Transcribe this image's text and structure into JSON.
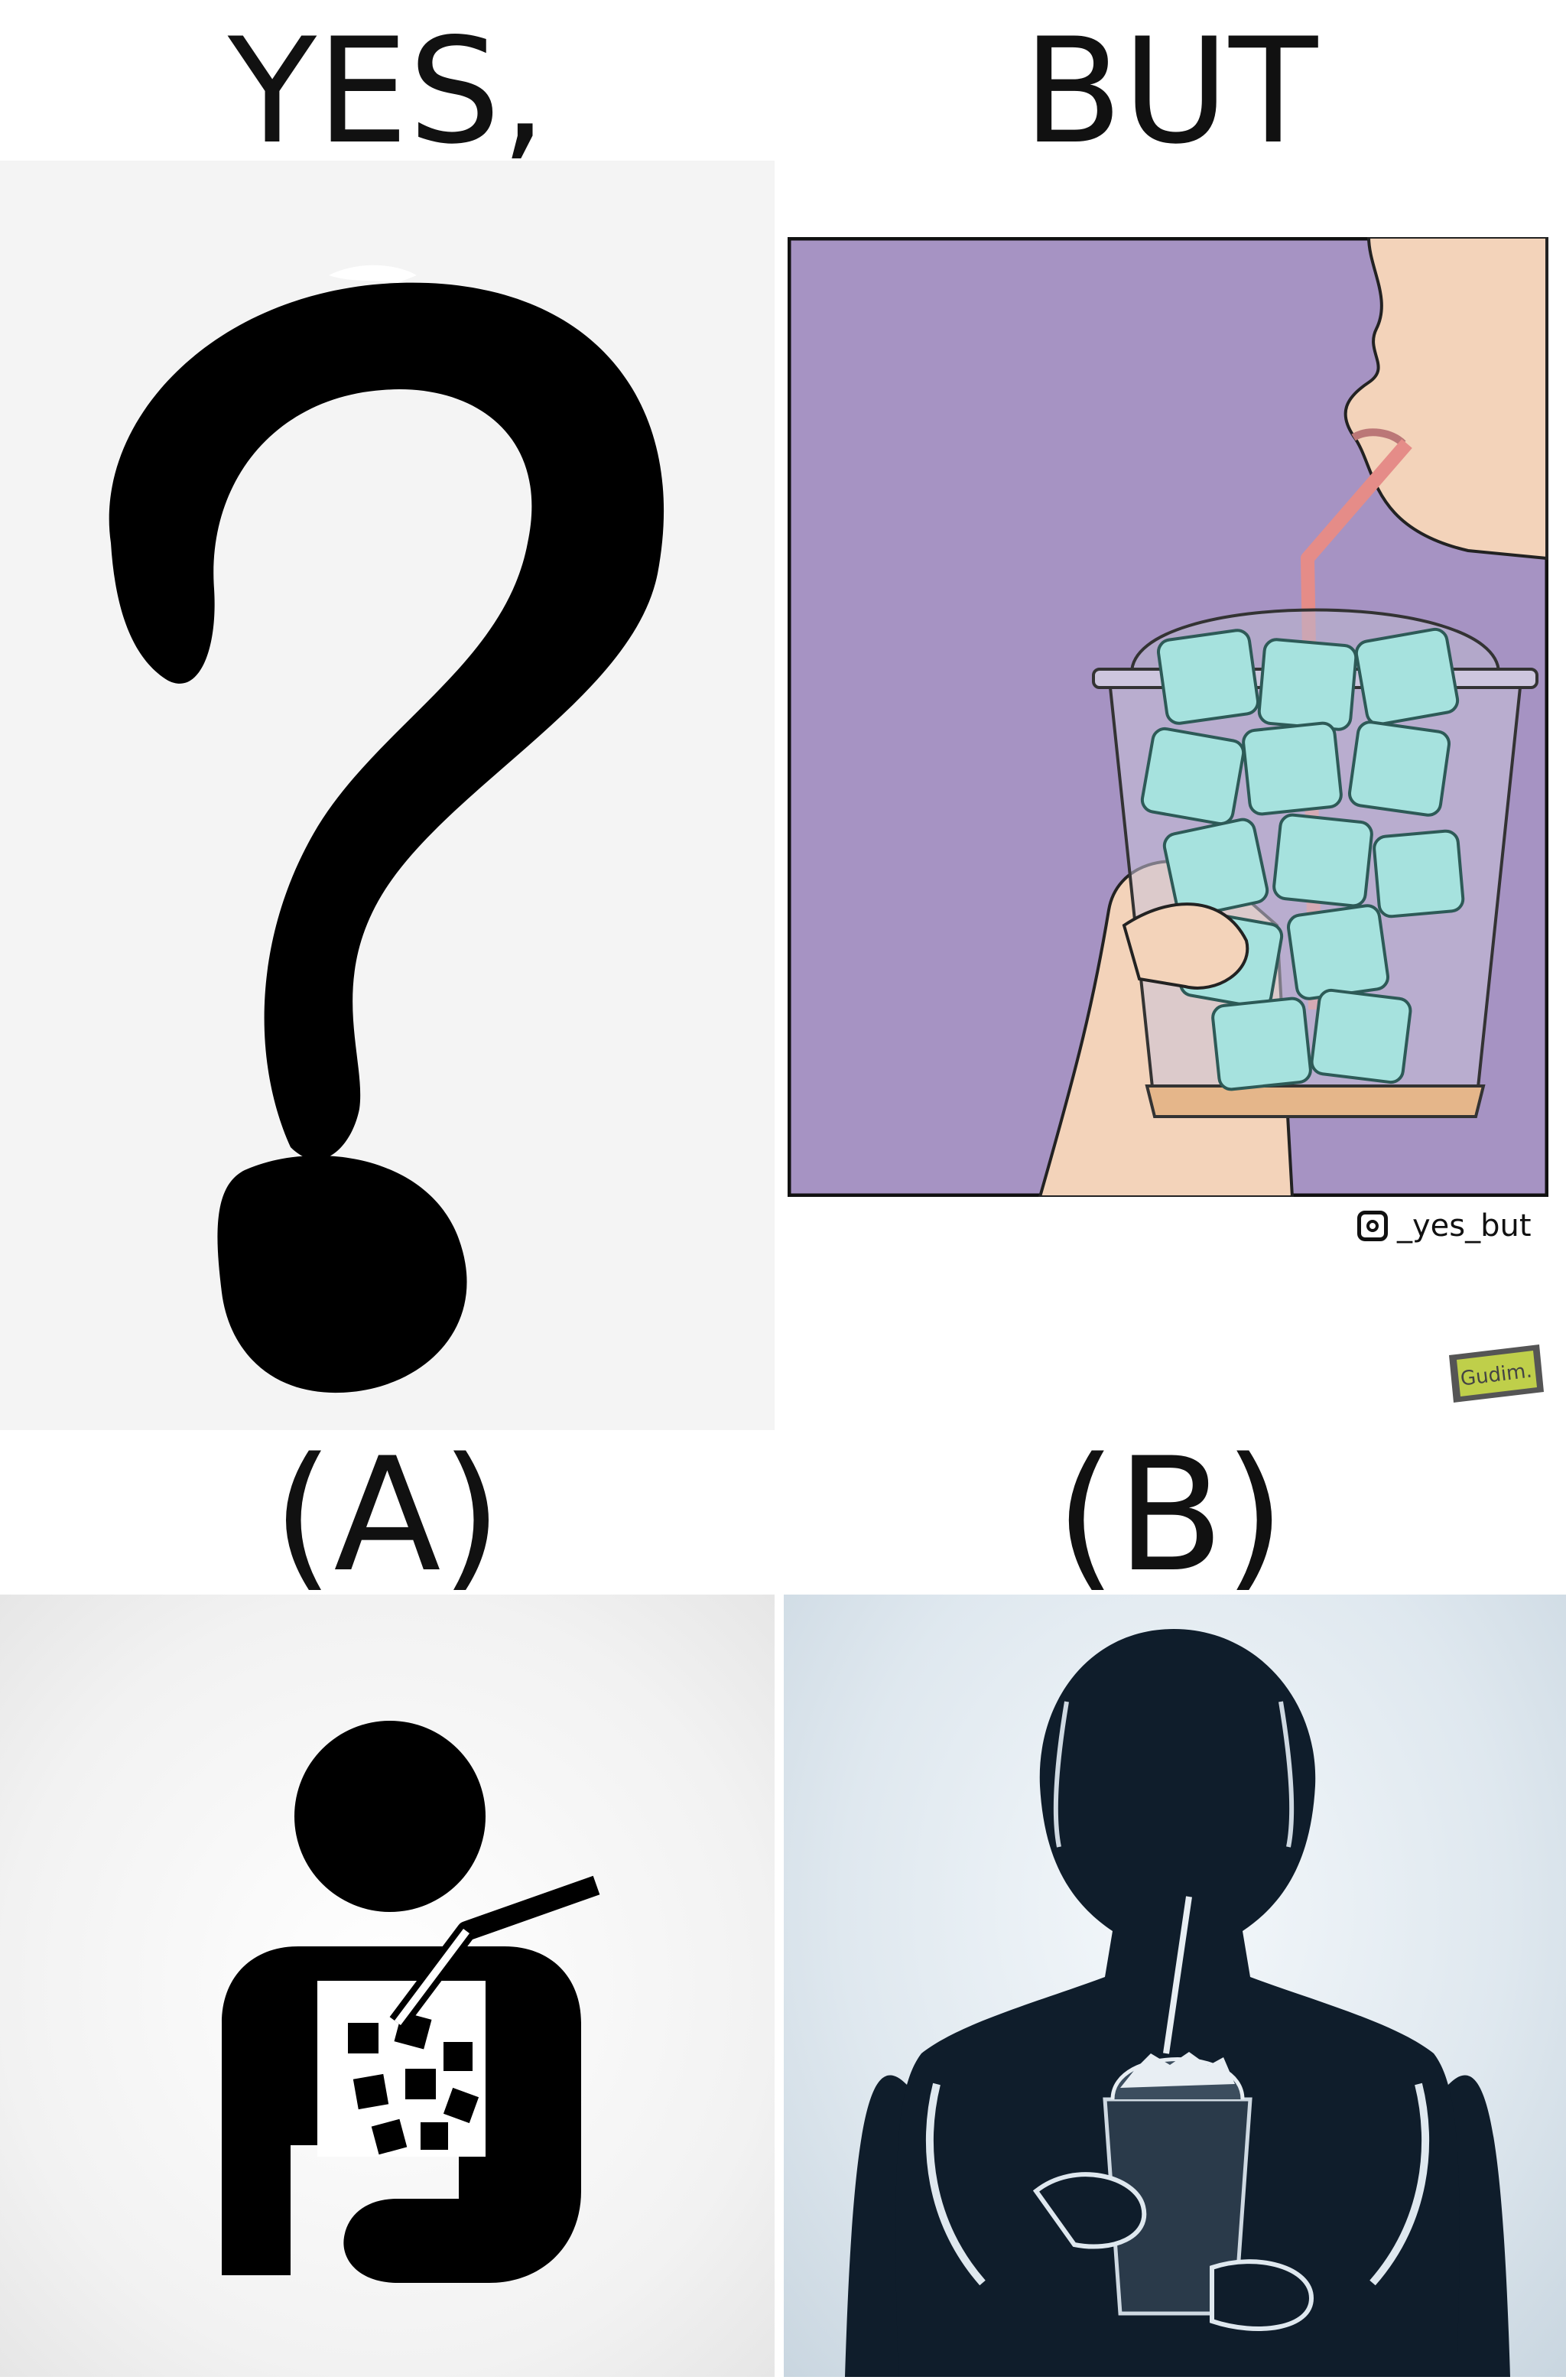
{
  "headings": {
    "left": "YES,",
    "right": "BUT"
  },
  "labels": {
    "a": "(A)",
    "b": "(B)"
  },
  "credit": {
    "instagram_handle": "_yes_but",
    "icon": "instagram-icon"
  },
  "badge": {
    "text": "Gudim."
  },
  "colors": {
    "comic_background": "#a693c3",
    "ice": "#a6e2de",
    "straw": "#e58c88",
    "skin": "#f3d3ba",
    "silhouette": "#0f1d2b"
  }
}
